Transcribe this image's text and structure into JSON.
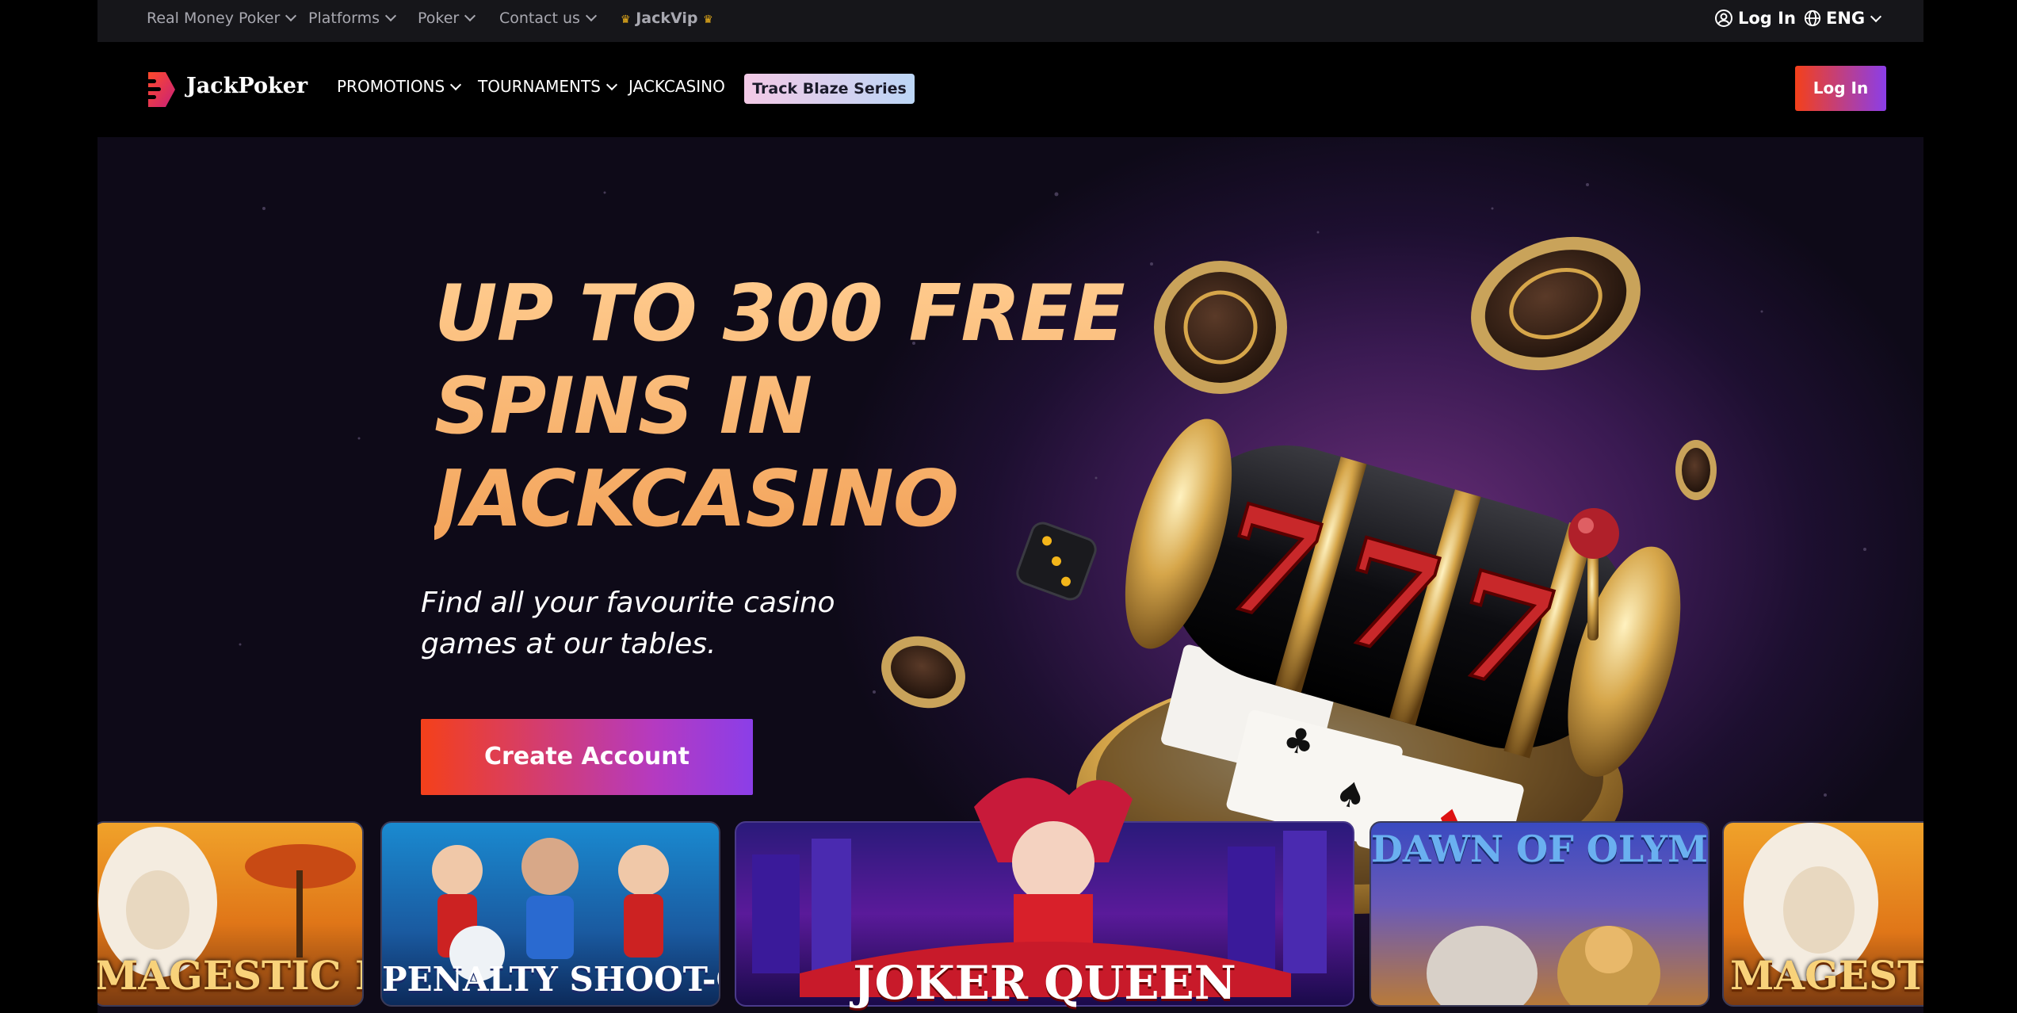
{
  "topbar": {
    "items": [
      {
        "label": "Real Money Poker"
      },
      {
        "label": "Platforms"
      },
      {
        "label": "Poker"
      },
      {
        "label": "Contact us"
      }
    ],
    "vip_label": "JackVip",
    "login_label": "Log In",
    "language": "ENG"
  },
  "nav": {
    "brand": "JackPoker",
    "links": [
      {
        "label": "PROMOTIONS"
      },
      {
        "label": "TOURNAMENTS"
      },
      {
        "label": "JACKCASINO"
      }
    ],
    "highlight_label": "Track Blaze Series",
    "login_button": "Log In"
  },
  "hero": {
    "headline": "UP TO 300 FREE SPINS IN JACKCASINO",
    "subtitle": "Find all your favourite casino games at our tables.",
    "cta_label": "Create Account"
  },
  "games": [
    {
      "title": "MAGESTIC KING"
    },
    {
      "title": "PENALTY SHOOT-OUT"
    },
    {
      "title": "JOKER QUEEN"
    },
    {
      "title": "DAWN OF OLYMPUS"
    },
    {
      "title": "MAGESTIC"
    }
  ],
  "colors": {
    "accent_start": "#f4401a",
    "accent_end": "#8b3ee8",
    "vip": "#f3b51a",
    "headline": "#f7b06a"
  }
}
